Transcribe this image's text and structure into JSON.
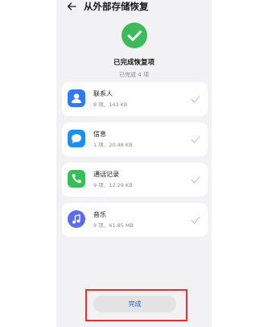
{
  "header": {
    "title": "从外部存储恢复",
    "back_icon": "arrow-left-icon"
  },
  "status": {
    "icon": "check-circle-icon",
    "icon_color": "#3dbb5b",
    "title": "已完成恢复项",
    "subtitle": "已完成 4 项"
  },
  "items": [
    {
      "name": "联系人",
      "meta": "8 项、143 KB",
      "icon": "contacts-icon",
      "icon_color": "#2f7bf5"
    },
    {
      "name": "信息",
      "meta": "1 项、20.48 KB",
      "icon": "messages-icon",
      "icon_color": "#1f8ef1"
    },
    {
      "name": "通话记录",
      "meta": "9 项、12.29 KB",
      "icon": "phone-icon",
      "icon_color": "#33c25a"
    },
    {
      "name": "音乐",
      "meta": "9 项、61.85 MB",
      "icon": "music-icon",
      "icon_color": "#5a6cf0"
    }
  ],
  "footer": {
    "done_label": "完成",
    "done_color": "#2a5ad8",
    "highlight_color": "#e0302f"
  }
}
